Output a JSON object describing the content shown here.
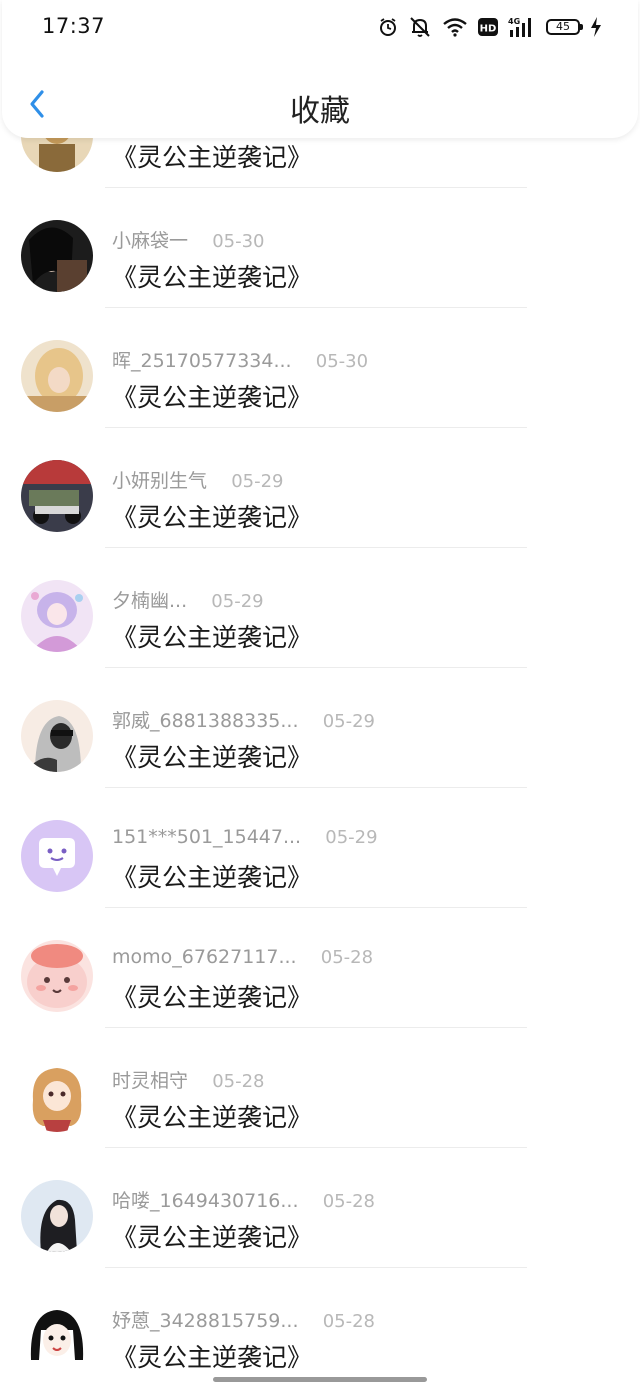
{
  "status_bar": {
    "time": "17:37",
    "network": "4G",
    "hd": "HD",
    "battery": "45"
  },
  "header": {
    "title": "收藏"
  },
  "items": [
    {
      "name": "",
      "date": "",
      "book": "《灵公主逆袭记》",
      "avatar": "avatar-1"
    },
    {
      "name": "小麻袋一",
      "date": "05-30",
      "book": "《灵公主逆袭记》",
      "avatar": "avatar-2"
    },
    {
      "name": "晖_25170577334...",
      "date": "05-30",
      "book": "《灵公主逆袭记》",
      "avatar": "avatar-3"
    },
    {
      "name": "小妍别生气",
      "date": "05-29",
      "book": "《灵公主逆袭记》",
      "avatar": "avatar-4"
    },
    {
      "name": "夕楠幽...",
      "date": "05-29",
      "book": "《灵公主逆袭记》",
      "avatar": "avatar-5"
    },
    {
      "name": "郭威_6881388335...",
      "date": "05-29",
      "book": "《灵公主逆袭记》",
      "avatar": "avatar-6"
    },
    {
      "name": "151***501_15447...",
      "date": "05-29",
      "book": "《灵公主逆袭记》",
      "avatar": "avatar-7"
    },
    {
      "name": "momo_67627117...",
      "date": "05-28",
      "book": "《灵公主逆袭记》",
      "avatar": "avatar-8"
    },
    {
      "name": "时灵相守",
      "date": "05-28",
      "book": "《灵公主逆袭记》",
      "avatar": "avatar-9"
    },
    {
      "name": "哈喽_1649430716...",
      "date": "05-28",
      "book": "《灵公主逆袭记》",
      "avatar": "avatar-10"
    },
    {
      "name": "妤蒽_3428815759...",
      "date": "05-28",
      "book": "《灵公主逆袭记》",
      "avatar": "avatar-11"
    }
  ],
  "colors": {
    "accent": "#2f8fe8",
    "text_primary": "#1a1a1a",
    "text_secondary": "#9a9a9a",
    "date": "#b8b8b8",
    "divider": "#ececec"
  }
}
